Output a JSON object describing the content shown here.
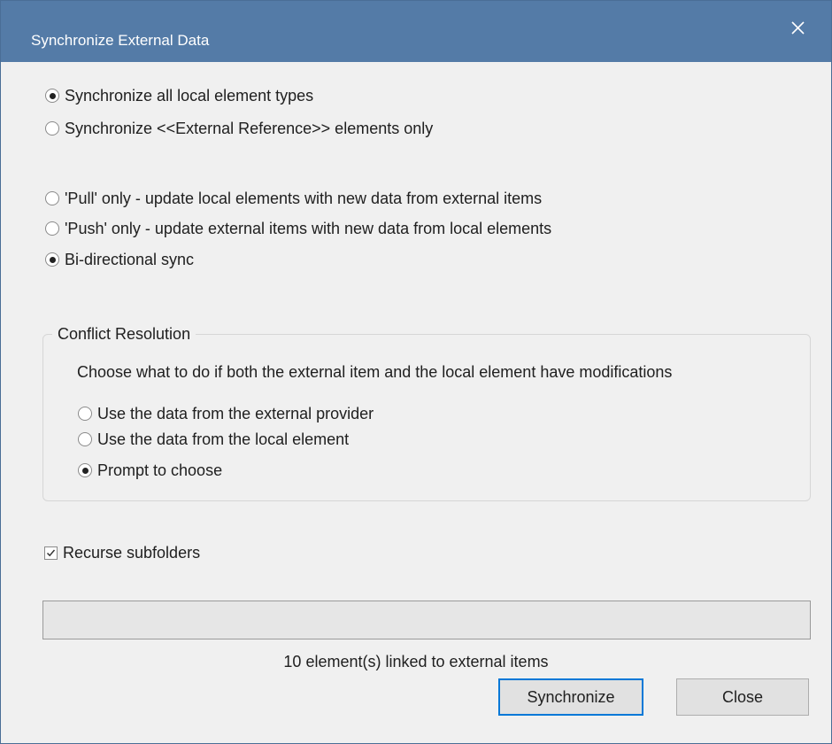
{
  "window": {
    "title": "Synchronize External Data",
    "close_icon": "close-x-icon"
  },
  "scope_options": [
    {
      "label": "Synchronize all local element types",
      "selected": true
    },
    {
      "label": "Synchronize <<External Reference>> elements only",
      "selected": false
    }
  ],
  "direction_options": [
    {
      "label": "'Pull' only - update local elements with new data from external items",
      "selected": false
    },
    {
      "label": "'Push' only - update external items with new data from local elements",
      "selected": false
    },
    {
      "label": "Bi-directional sync",
      "selected": true
    }
  ],
  "conflict": {
    "legend": "Conflict Resolution",
    "description": "Choose what to do if both the external item and the local element have modifications",
    "options": [
      {
        "label": "Use the data from the external provider",
        "selected": false
      },
      {
        "label": "Use the data from the local element",
        "selected": false
      },
      {
        "label": "Prompt to choose",
        "selected": true
      }
    ]
  },
  "recurse": {
    "label": "Recurse subfolders",
    "checked": true
  },
  "progress": {
    "value": 0
  },
  "status_text": "10 element(s) linked to external items",
  "buttons": {
    "synchronize": "Synchronize",
    "close": "Close"
  },
  "colors": {
    "titlebar": "#547ba7",
    "dialog_bg": "#f0f0f0",
    "default_button_border": "#0078d7"
  }
}
